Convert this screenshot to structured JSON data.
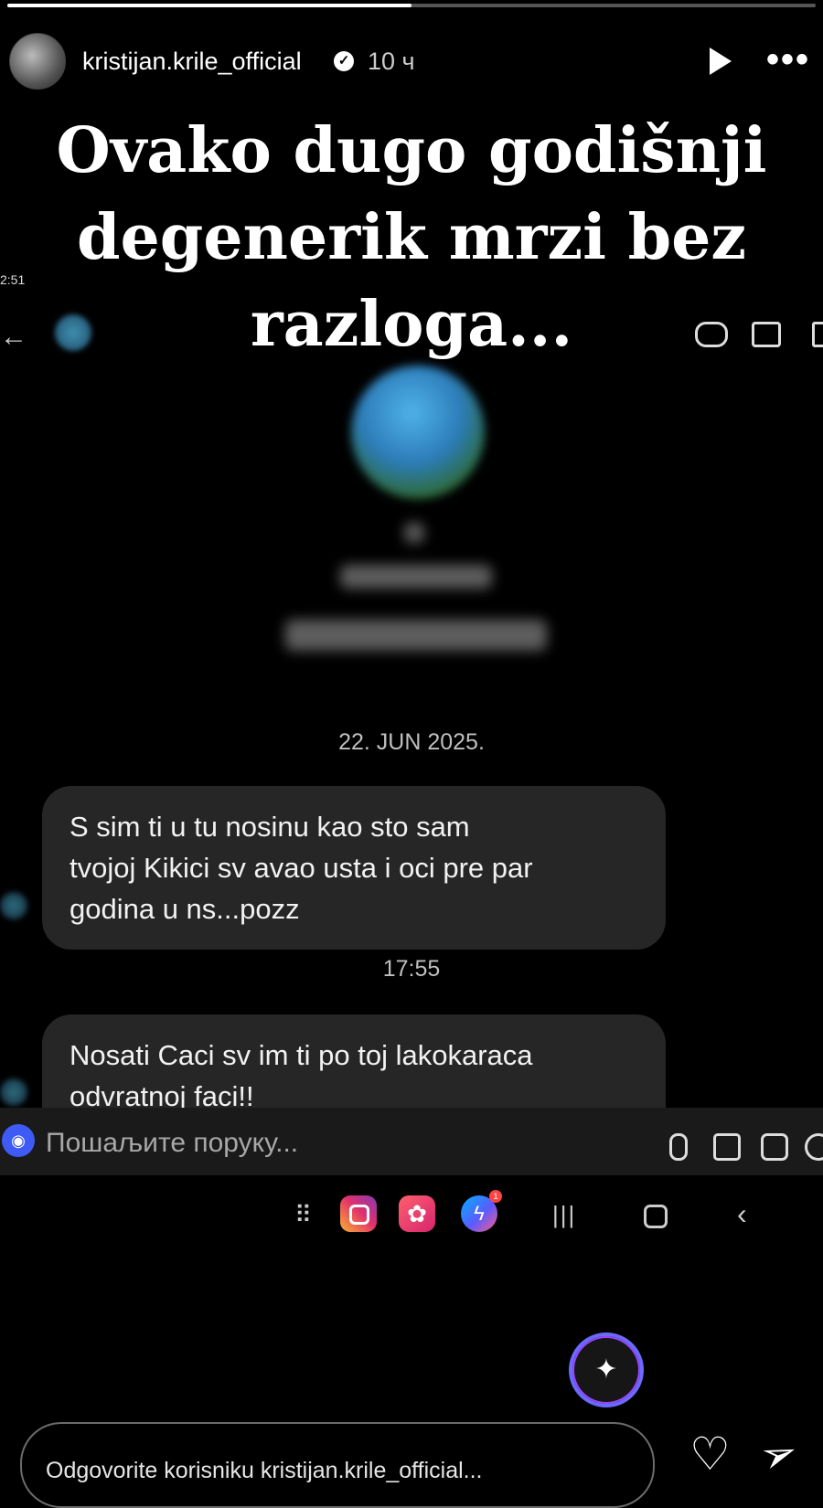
{
  "story": {
    "progress": 0.5,
    "username": "kristijan.krile_official",
    "verified_mark": "✓",
    "time_ago": "10 ч",
    "icons": {
      "play": "play-icon",
      "more": "more-icon",
      "verified": "verified-badge-icon"
    }
  },
  "headline": {
    "line1": "Ovako dugo godišnji",
    "line2": "degenerik mrzi bez",
    "line3": "razloga..."
  },
  "screenshot": {
    "status_time": "2:51",
    "thread": {
      "date_separator": "22. JUN 2025.",
      "time_separator": "17:55",
      "messages": [
        {
          "line1": "S     sim ti u tu nosinu kao sto sam",
          "line2": "tvojoj Kikici sv     avao usta i oci pre par",
          "line3": "godina u ns...pozz"
        },
        {
          "line1": "Nosati Caci sv     im ti po toj lakokaraca",
          "line2": "odvratnoj faci!!"
        }
      ]
    },
    "composer": {
      "placeholder": "Пошаљите поруку..."
    },
    "app_badge_count": "1"
  },
  "reply": {
    "placeholder": "Odgovorite korisniku kristijan.krile_official...",
    "icons": {
      "like": "heart-icon",
      "share": "send-icon",
      "ai": "sparkle-icon"
    }
  }
}
